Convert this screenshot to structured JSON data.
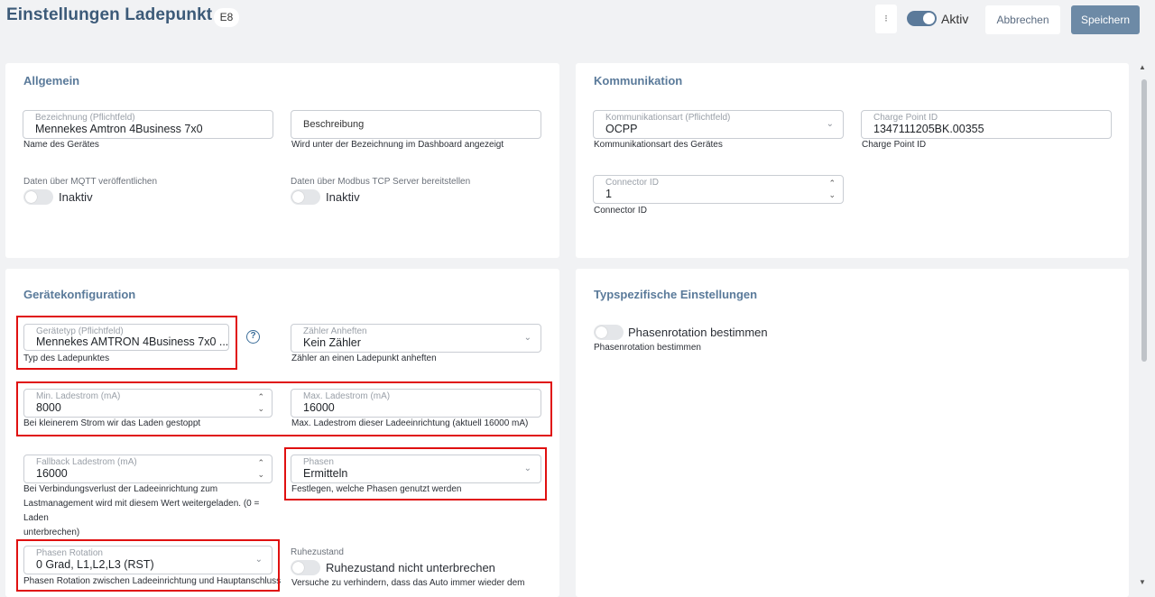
{
  "header": {
    "title": "Einstellungen Ladepunkt",
    "badge": "E8",
    "menu_icon": "⁝",
    "active_label": "Aktiv",
    "cancel_label": "Abbrechen",
    "save_label": "Speichern"
  },
  "allgemein": {
    "title": "Allgemein",
    "bezeichnung": {
      "label": "Bezeichnung (Pflichtfeld)",
      "value": "Mennekes Amtron 4Business 7x0",
      "hint": "Name des Gerätes"
    },
    "beschreibung": {
      "placeholder": "Beschreibung",
      "hint": "Wird unter der Bezeichnung im Dashboard angezeigt"
    },
    "mqtt": {
      "label": "Daten über MQTT veröffentlichen",
      "state": "Inaktiv"
    },
    "modbus": {
      "label": "Daten über Modbus TCP Server bereitstellen",
      "state": "Inaktiv"
    }
  },
  "kommunikation": {
    "title": "Kommunikation",
    "art": {
      "label": "Kommunikationsart (Pflichtfeld)",
      "value": "OCPP",
      "hint": "Kommunikationsart des Gerätes"
    },
    "charge_point": {
      "label": "Charge Point ID",
      "value": "1347111205BK.00355",
      "hint": "Charge Point ID"
    },
    "connector": {
      "label": "Connector ID",
      "value": "1",
      "hint": "Connector ID"
    }
  },
  "geraet": {
    "title": "Gerätekonfiguration",
    "typ": {
      "label": "Gerätetyp (Pflichtfeld)",
      "value": "Mennekes AMTRON 4Business 7x0 ...",
      "hint": "Typ des Ladepunktes",
      "help": "?"
    },
    "zaehler": {
      "label": "Zähler Anheften",
      "value": "Kein Zähler",
      "hint": "Zähler an einen Ladepunkt anheften"
    },
    "min": {
      "label": "Min. Ladestrom (mA)",
      "value": "8000",
      "hint": "Bei kleinerem Strom wir das Laden gestoppt"
    },
    "max": {
      "label": "Max. Ladestrom (mA)",
      "value": "16000",
      "hint": "Max. Ladestrom dieser Ladeeinrichtung (aktuell 16000 mA)"
    },
    "fallback": {
      "label": "Fallback Ladestrom (mA)",
      "value": "16000",
      "hint_1": "Bei Verbindungsverlust der Ladeeinrichtung zum",
      "hint_2": "Lastmanagement wird mit diesem Wert weitergeladen. (0 = Laden",
      "hint_3": "unterbrechen)"
    },
    "phasen": {
      "label": "Phasen",
      "value": "Ermitteln",
      "hint": "Festlegen, welche Phasen genutzt werden"
    },
    "rotation": {
      "label": "Phasen Rotation",
      "value": "0 Grad, L1,L2,L3 (RST)",
      "hint": "Phasen Rotation zwischen Ladeeinrichtung und Hauptanschluss"
    },
    "ruhe": {
      "label": "Ruhezustand",
      "state": "Ruhezustand nicht unterbrechen",
      "hint": "Versuche zu verhindern, dass das Auto immer wieder dem"
    }
  },
  "typspez": {
    "title": "Typspezifische Einstellungen",
    "rotation_toggle": {
      "state": "Phasenrotation bestimmen",
      "hint": "Phasenrotation bestimmen"
    }
  },
  "icons": {
    "chevron": "⌄",
    "up": "▲",
    "down": "▼",
    "spin_up": "⌃",
    "spin_down": "⌄"
  },
  "colors": {
    "accent": "#5b7a9a",
    "title": "#3c5a78",
    "save": "#6d8aa6",
    "highlight": "#e01010"
  }
}
